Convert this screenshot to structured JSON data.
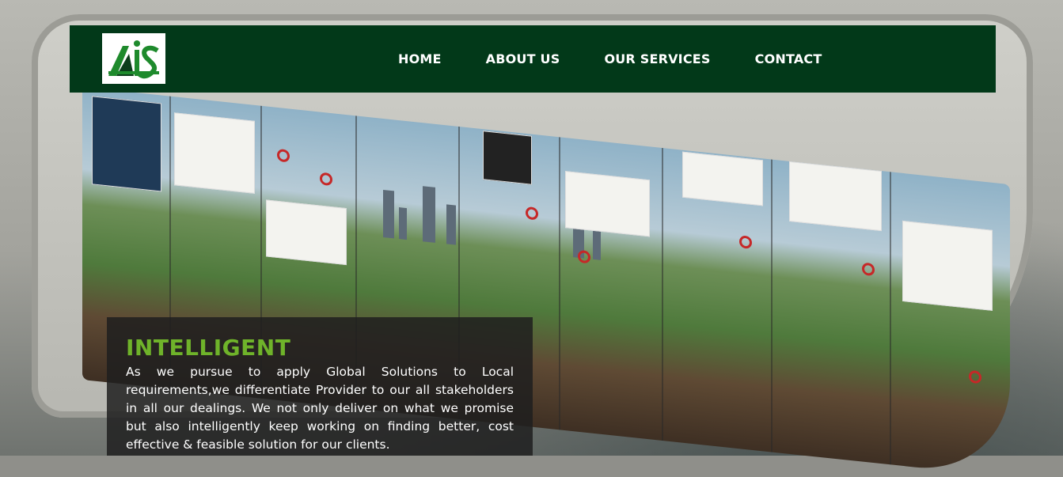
{
  "brand": {
    "logo_text": "AIS",
    "colors": {
      "nav_bg": "#023919",
      "logo_green": "#1e8a2c",
      "logo_dark": "#0b3d1a",
      "accent": "#6fb32a"
    }
  },
  "nav": {
    "items": [
      {
        "label": "HOME"
      },
      {
        "label": "ABOUT US"
      },
      {
        "label": "OUR SERVICES"
      },
      {
        "label": "CONTACT"
      }
    ]
  },
  "hero": {
    "heading": "INTELLIGENT",
    "body": "As we pursue to apply Global Solutions to Local requirements,we differentiate Provider to our all stakeholders in all our dealings. We not only deliver on what we promise but also intelligently keep working on finding better, cost effective & feasible solution for our clients."
  }
}
